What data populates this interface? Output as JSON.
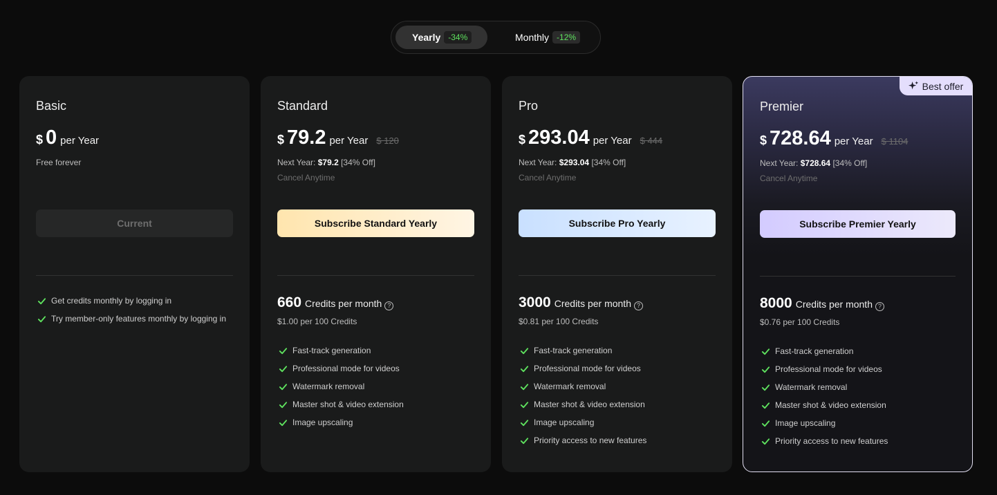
{
  "billing_toggle": {
    "yearly": {
      "label": "Yearly",
      "discount": "-34%"
    },
    "monthly": {
      "label": "Monthly",
      "discount": "-12%"
    }
  },
  "colors": {
    "accent_green": "#5fe35f",
    "background": "#0c0c0c",
    "card": "#1a1b1b"
  },
  "plans": [
    {
      "name": "Basic",
      "currency": "$",
      "price": "0",
      "period": "per Year",
      "note": "Free forever",
      "button": "Current",
      "features": [
        "Get credits monthly by logging in",
        "Try member-only features monthly by logging in"
      ]
    },
    {
      "name": "Standard",
      "currency": "$",
      "price": "79.2",
      "period": "per Year",
      "old_price": "$ 120",
      "next_year_label": "Next Year:",
      "next_year_price": "$79.2",
      "next_year_off": "[34% Off]",
      "cancel": "Cancel Anytime",
      "button": "Subscribe Standard Yearly",
      "credits": "660",
      "credits_label": "Credits per month",
      "credits_rate": "$1.00 per 100 Credits",
      "features": [
        "Fast-track generation",
        "Professional mode for videos",
        "Watermark removal",
        "Master shot & video extension",
        "Image upscaling"
      ]
    },
    {
      "name": "Pro",
      "currency": "$",
      "price": "293.04",
      "period": "per Year",
      "old_price": "$ 444",
      "next_year_label": "Next Year:",
      "next_year_price": "$293.04",
      "next_year_off": "[34% Off]",
      "cancel": "Cancel Anytime",
      "button": "Subscribe Pro Yearly",
      "credits": "3000",
      "credits_label": "Credits per month",
      "credits_rate": "$0.81 per 100 Credits",
      "features": [
        "Fast-track generation",
        "Professional mode for videos",
        "Watermark removal",
        "Master shot & video extension",
        "Image upscaling",
        "Priority access to new features"
      ]
    },
    {
      "name": "Premier",
      "badge": "Best offer",
      "currency": "$",
      "price": "728.64",
      "period": "per Year",
      "old_price": "$ 1104",
      "next_year_label": "Next Year:",
      "next_year_price": "$728.64",
      "next_year_off": "[34% Off]",
      "cancel": "Cancel Anytime",
      "button": "Subscribe Premier Yearly",
      "credits": "8000",
      "credits_label": "Credits per month",
      "credits_rate": "$0.76 per 100 Credits",
      "features": [
        "Fast-track generation",
        "Professional mode for videos",
        "Watermark removal",
        "Master shot & video extension",
        "Image upscaling",
        "Priority access to new features"
      ]
    }
  ]
}
